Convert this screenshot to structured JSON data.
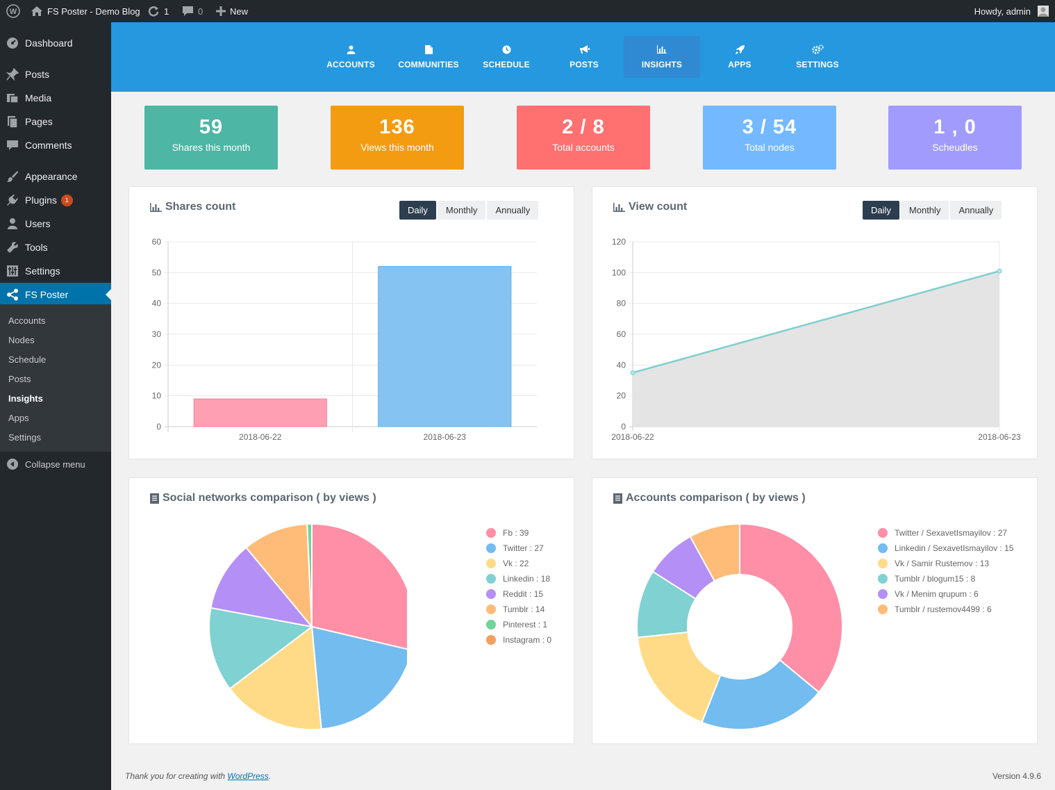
{
  "adminbar": {
    "site_name": "FS Poster - Demo Blog",
    "updates_count": "1",
    "comments_count": "0",
    "new_label": "New",
    "greeting": "Howdy, admin"
  },
  "sidebar": {
    "items": [
      {
        "label": "Dashboard",
        "icon": "dashboard-icon"
      },
      {
        "label": "Posts",
        "icon": "pin-icon"
      },
      {
        "label": "Media",
        "icon": "media-icon"
      },
      {
        "label": "Pages",
        "icon": "pages-icon"
      },
      {
        "label": "Comments",
        "icon": "comment-icon"
      },
      {
        "label": "Appearance",
        "icon": "brush-icon"
      },
      {
        "label": "Plugins",
        "icon": "plugin-icon",
        "badge": "1"
      },
      {
        "label": "Users",
        "icon": "user-icon"
      },
      {
        "label": "Tools",
        "icon": "wrench-icon"
      },
      {
        "label": "Settings",
        "icon": "settings-icon"
      },
      {
        "label": "FS Poster",
        "icon": "share-icon"
      }
    ],
    "submenu": [
      "Accounts",
      "Nodes",
      "Schedule",
      "Posts",
      "Insights",
      "Apps",
      "Settings"
    ],
    "collapse_label": "Collapse menu"
  },
  "topnav": {
    "tabs": [
      "ACCOUNTS",
      "COMMUNITIES",
      "SCHEDULE",
      "POSTS",
      "INSIGHTS",
      "APPS",
      "SETTINGS"
    ],
    "active": "INSIGHTS"
  },
  "stats": [
    {
      "value": "59",
      "label": "Shares this month",
      "color": "#4db6a4"
    },
    {
      "value": "136",
      "label": "Views this month",
      "color": "#f39c12"
    },
    {
      "value": "2 / 8",
      "label": "Total accounts",
      "color": "#ff7070"
    },
    {
      "value": "3 / 54",
      "label": "Total nodes",
      "color": "#74b9ff"
    },
    {
      "value": "1 , 0",
      "label": "Scheudles",
      "color": "#a29bfe"
    }
  ],
  "panels": {
    "shares": {
      "title": "Shares count",
      "buttons": [
        "Daily",
        "Monthly",
        "Annually"
      ],
      "selected": "Daily"
    },
    "views": {
      "title": "View count",
      "buttons": [
        "Daily",
        "Monthly",
        "Annually"
      ],
      "selected": "Daily"
    },
    "social": {
      "title": "Social networks comparison ( by views )"
    },
    "accounts": {
      "title": "Accounts comparison ( by views )"
    }
  },
  "chart_data": [
    {
      "type": "bar",
      "title": "Shares count",
      "categories": [
        "2018-06-22",
        "2018-06-23"
      ],
      "values": [
        9,
        52
      ],
      "colors": [
        "#ff9fb3",
        "#85c4f2"
      ],
      "ylim": [
        0,
        60
      ],
      "yticks": [
        0,
        10,
        20,
        30,
        40,
        50,
        60
      ]
    },
    {
      "type": "area",
      "title": "View count",
      "categories": [
        "2018-06-22",
        "2018-06-23"
      ],
      "values": [
        35,
        101
      ],
      "color": "#7ecfcf",
      "ylim": [
        0,
        120
      ],
      "yticks": [
        0,
        20,
        40,
        60,
        80,
        100,
        120
      ]
    },
    {
      "type": "pie",
      "title": "Social networks comparison ( by views )",
      "labels": [
        "Fb : 39",
        "Twitter : 27",
        "Vk : 22",
        "Linkedin : 18",
        "Reddit : 15",
        "Tumblr : 14",
        "Pinterest : 1",
        "Instagram : 0"
      ],
      "values": [
        39,
        27,
        22,
        18,
        15,
        14,
        1,
        0
      ],
      "colors": [
        "#ff8fa7",
        "#72bcef",
        "#ffdb87",
        "#80d1d1",
        "#b48ff5",
        "#ffbb78",
        "#6fd59a",
        "#f0a061"
      ]
    },
    {
      "type": "pie",
      "title": "Accounts comparison ( by views )",
      "donut": true,
      "labels": [
        "Twitter / SexavetIsmayilov : 27",
        "Linkedin / SexavetIsmayilov : 15",
        "Vk / Samir Rustemov : 13",
        "Tumblr / blogum15 : 8",
        "Vk / Menim qrupum : 6",
        "Tumblr / rustemov4499 : 6"
      ],
      "values": [
        27,
        15,
        13,
        8,
        6,
        6
      ],
      "colors": [
        "#ff8fa7",
        "#72bcef",
        "#ffdb87",
        "#80d1d1",
        "#b48ff5",
        "#ffbb78"
      ]
    }
  ],
  "footer": {
    "thanks_prefix": "Thank you for creating with ",
    "link": "WordPress",
    "suffix": ".",
    "version": "Version 4.9.6"
  }
}
